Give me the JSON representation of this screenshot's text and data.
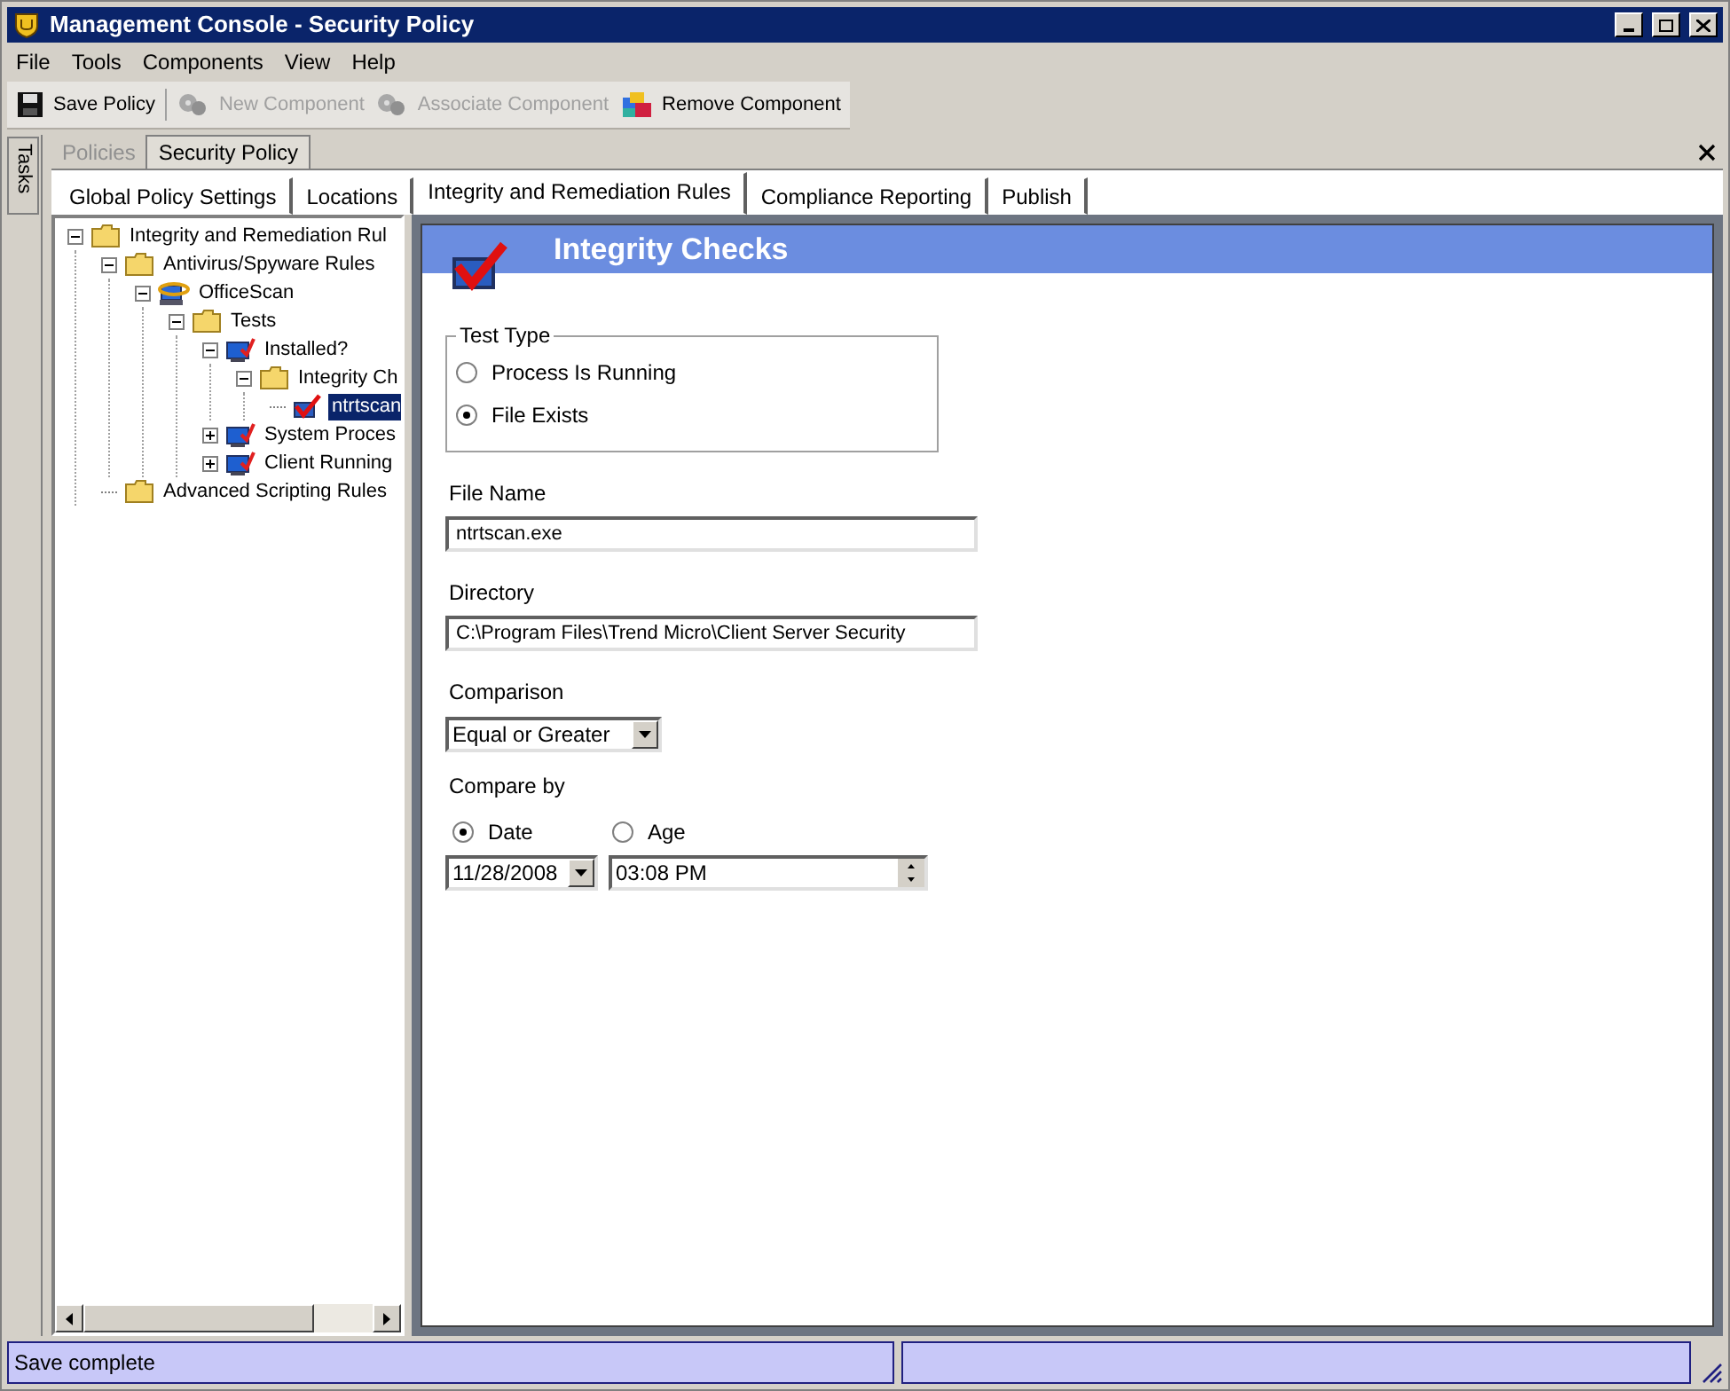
{
  "window": {
    "title": "Management Console - Security Policy"
  },
  "menu": [
    "File",
    "Tools",
    "Components",
    "View",
    "Help"
  ],
  "toolbar": [
    {
      "label": "Save Policy",
      "kind": "disk",
      "disabled": false
    },
    {
      "label": "New Component",
      "kind": "gears",
      "disabled": true
    },
    {
      "label": "Associate Component",
      "kind": "gears",
      "disabled": true
    },
    {
      "label": "Remove Component",
      "kind": "blocks",
      "disabled": false
    }
  ],
  "side_tab": "Tasks",
  "document_tabs": [
    {
      "label": "Policies",
      "selected": false
    },
    {
      "label": "Security Policy",
      "selected": true
    }
  ],
  "tabs": [
    {
      "label": "Global Policy Settings",
      "selected": false
    },
    {
      "label": "Locations",
      "selected": false
    },
    {
      "label": "Integrity and Remediation Rules",
      "selected": true
    },
    {
      "label": "Compliance Reporting",
      "selected": false
    },
    {
      "label": "Publish",
      "selected": false
    }
  ],
  "tree": [
    {
      "label": "Integrity and Remediation Rul",
      "kind": "folder",
      "expanded": true,
      "selected": false,
      "children": [
        {
          "label": "Antivirus/Spyware Rules",
          "kind": "folder",
          "expanded": true,
          "selected": false,
          "children": [
            {
              "label": "OfficeScan",
              "kind": "app",
              "expanded": true,
              "selected": false,
              "children": [
                {
                  "label": "Tests",
                  "kind": "folder",
                  "expanded": true,
                  "selected": false,
                  "children": [
                    {
                      "label": "Installed?",
                      "kind": "monitor",
                      "expanded": true,
                      "selected": false,
                      "children": [
                        {
                          "label": "Integrity Ch",
                          "kind": "folder",
                          "expanded": true,
                          "selected": false,
                          "children": [
                            {
                              "label": "ntrtscan",
                              "kind": "check",
                              "selected": true
                            }
                          ]
                        }
                      ]
                    },
                    {
                      "label": "System Proces",
                      "kind": "monitor",
                      "expanded": false,
                      "selected": false
                    },
                    {
                      "label": "Client Running",
                      "kind": "monitor",
                      "expanded": false,
                      "selected": false
                    }
                  ]
                }
              ]
            }
          ]
        },
        {
          "label": "Advanced Scripting Rules",
          "kind": "folder",
          "selected": false
        }
      ]
    }
  ],
  "panel": {
    "title": "Integrity Checks",
    "test_type": {
      "label": "Test Type",
      "options": [
        {
          "label": "Process Is Running",
          "selected": false
        },
        {
          "label": "File Exists",
          "selected": true
        }
      ]
    },
    "fields": [
      {
        "label": "File Name",
        "value": "ntrtscan.exe"
      },
      {
        "label": "Directory",
        "value": "C:\\Program Files\\Trend Micro\\Client Server Security"
      }
    ],
    "comparison": {
      "label": "Comparison",
      "value": "Equal or Greater"
    },
    "compare_by": {
      "label": "Compare by",
      "options": [
        {
          "label": "Date",
          "selected": true
        },
        {
          "label": "Age",
          "selected": false
        }
      ],
      "date": "11/28/2008",
      "time": "03:08 PM"
    }
  },
  "status_bar": [
    "Save complete"
  ]
}
